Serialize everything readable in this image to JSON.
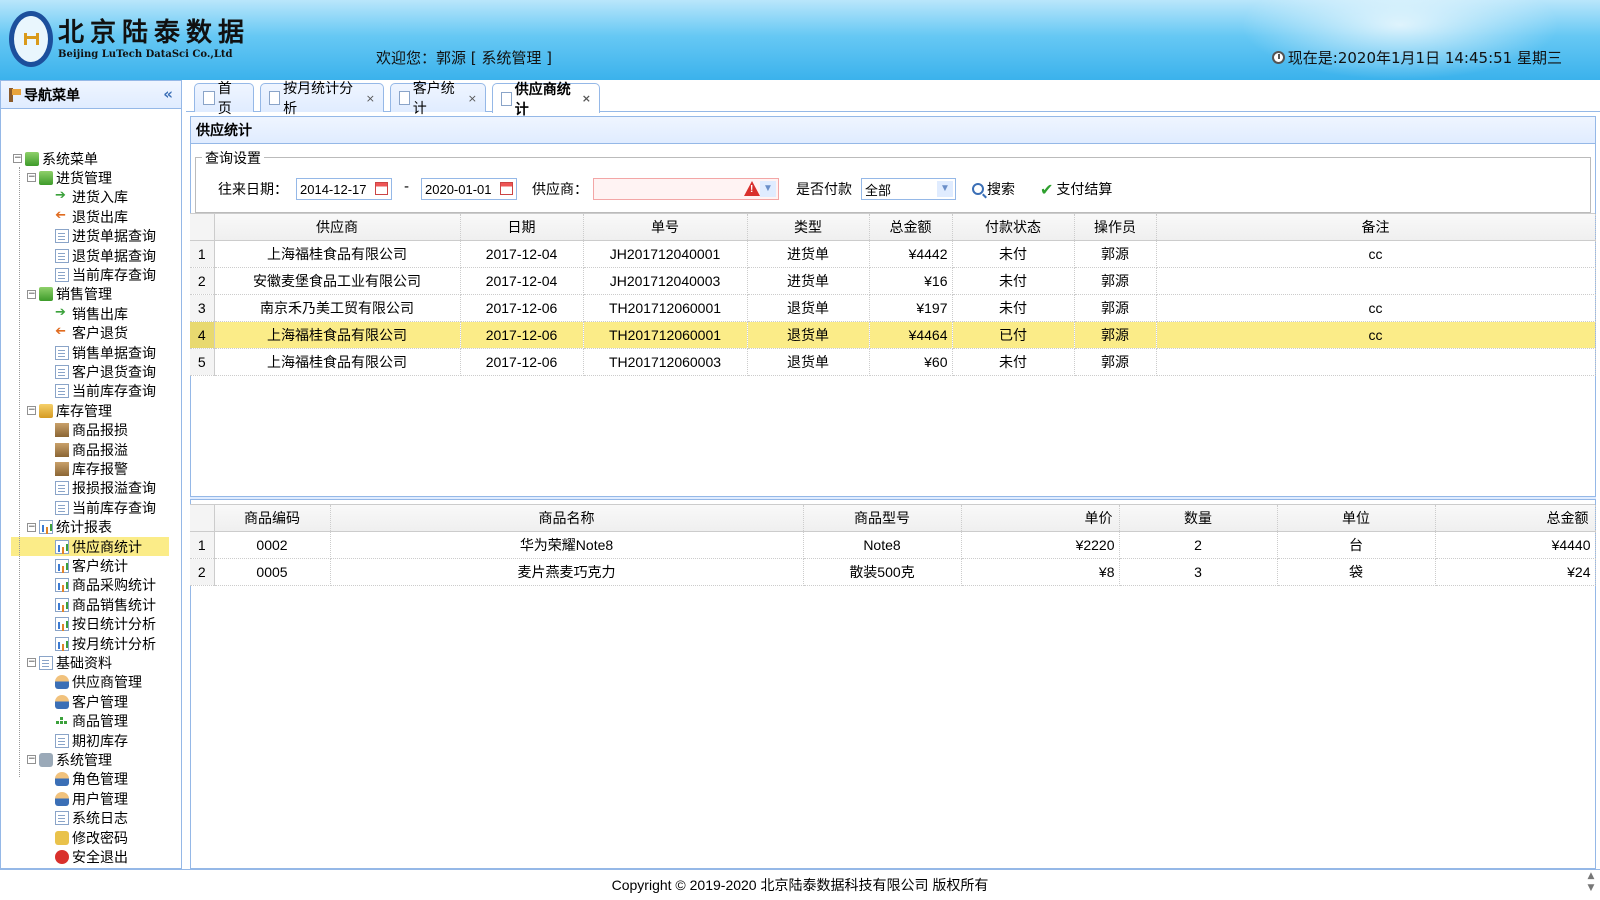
{
  "header": {
    "logo_cn": "北京陆泰数据",
    "logo_en": "Beijing LuTech DataSci Co.,Ltd",
    "welcome": "欢迎您：郭源 [ 系统管理 ]",
    "clock": "现在是:2020年1月1日 14:45:51 星期三"
  },
  "sidebar": {
    "title": "导航菜单",
    "root": "系统菜单",
    "groups": [
      {
        "label": "进货管理",
        "items": [
          "进货入库",
          "退货出库",
          "进货单据查询",
          "退货单据查询",
          "当前库存查询"
        ]
      },
      {
        "label": "销售管理",
        "items": [
          "销售出库",
          "客户退货",
          "销售单据查询",
          "客户退货查询",
          "当前库存查询"
        ]
      },
      {
        "label": "库存管理",
        "items": [
          "商品报损",
          "商品报溢",
          "库存报警",
          "报损报溢查询",
          "当前库存查询"
        ]
      },
      {
        "label": "统计报表",
        "items": [
          "供应商统计",
          "客户统计",
          "商品采购统计",
          "商品销售统计",
          "按日统计分析",
          "按月统计分析"
        ]
      },
      {
        "label": "基础资料",
        "items": [
          "供应商管理",
          "客户管理",
          "商品管理",
          "期初库存"
        ]
      },
      {
        "label": "系统管理",
        "items": [
          "角色管理",
          "用户管理",
          "系统日志",
          "修改密码",
          "安全退出"
        ]
      }
    ]
  },
  "tabs": [
    {
      "label": "首页"
    },
    {
      "label": "按月统计分析"
    },
    {
      "label": "客户统计"
    },
    {
      "label": "供应商统计"
    }
  ],
  "panel": {
    "title": "供应统计",
    "query_legend": "查询设置",
    "date_label": "往来日期：",
    "date_from": "2014-12-17",
    "date_sep": "-",
    "date_to": "2020-01-01",
    "supplier_label": "供应商：",
    "supplier_value": "",
    "paid_label": "是否付款",
    "paid_value": "全部",
    "search_label": "搜索",
    "pay_label": "支付结算"
  },
  "orders": {
    "columns": [
      "供应商",
      "日期",
      "单号",
      "类型",
      "总金额",
      "付款状态",
      "操作员",
      "备注"
    ],
    "rows": [
      {
        "n": "1",
        "supplier": "上海福桂食品有限公司",
        "date": "2017-12-04",
        "no": "JH201712040001",
        "type": "进货单",
        "amount": "¥4442",
        "status": "未付",
        "operator": "郭源",
        "note": "cc"
      },
      {
        "n": "2",
        "supplier": "安徽麦堡食品工业有限公司",
        "date": "2017-12-04",
        "no": "JH201712040003",
        "type": "进货单",
        "amount": "¥16",
        "status": "未付",
        "operator": "郭源",
        "note": ""
      },
      {
        "n": "3",
        "supplier": "南京禾乃美工贸有限公司",
        "date": "2017-12-06",
        "no": "TH201712060001",
        "type": "退货单",
        "amount": "¥197",
        "status": "未付",
        "operator": "郭源",
        "note": "cc"
      },
      {
        "n": "4",
        "supplier": "上海福桂食品有限公司",
        "date": "2017-12-06",
        "no": "TH201712060001",
        "type": "退货单",
        "amount": "¥4464",
        "status": "已付",
        "operator": "郭源",
        "note": "cc"
      },
      {
        "n": "5",
        "supplier": "上海福桂食品有限公司",
        "date": "2017-12-06",
        "no": "TH201712060003",
        "type": "退货单",
        "amount": "¥60",
        "status": "未付",
        "operator": "郭源",
        "note": ""
      }
    ]
  },
  "items": {
    "columns": [
      "商品编码",
      "商品名称",
      "商品型号",
      "单价",
      "数量",
      "单位",
      "总金额"
    ],
    "rows": [
      {
        "n": "1",
        "code": "0002",
        "name": "华为荣耀Note8",
        "model": "Note8",
        "price": "¥2220",
        "qty": "2",
        "unit": "台",
        "total": "¥4440"
      },
      {
        "n": "2",
        "code": "0005",
        "name": "麦片燕麦巧克力",
        "model": "散装500克",
        "price": "¥8",
        "qty": "3",
        "unit": "袋",
        "total": "¥24"
      }
    ]
  },
  "footer": {
    "copyright": "Copyright © 2019-2020 北京陆泰数据科技有限公司 版权所有"
  },
  "colors": {
    "header_blue": "#3bb2ec",
    "panel_border": "#95b8e7",
    "selected_row": "#fbec88"
  }
}
